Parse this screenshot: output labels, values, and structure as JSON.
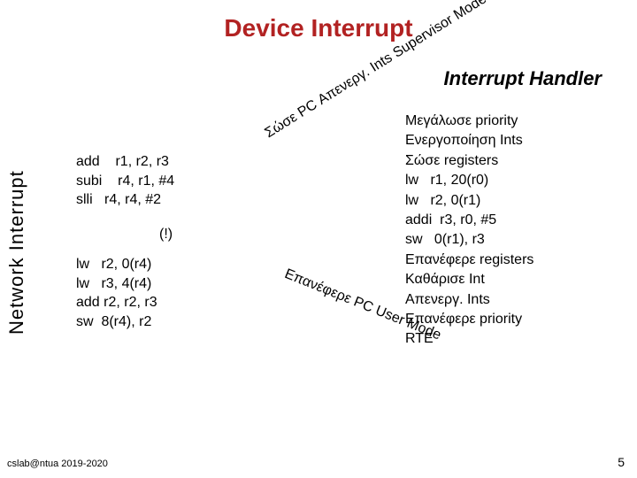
{
  "title": "Device Interrupt",
  "subtitle": "Interrupt Handler",
  "vertical_label": "Network Interrupt",
  "code_block1": "add    r1, r2, r3\nsubi    r4, r1, #4\nslli   r4, r4, #2",
  "exclaim": "(!)",
  "code_block2": "lw   r2, 0(r4)\nlw   r3, 4(r4)\nadd r2, r2, r3\nsw  8(r4), r2",
  "diag1": "Σώσε PC\nΑπενεργ. Ints\nSupervisor Mode",
  "diag2": "Επανέφερε PC\nUser Mode",
  "handler": "Μεγάλωσε priority\nΕνεργοποίηση Ints\nΣώσε registers\nlw   r1, 20(r0)\nlw   r2, 0(r1)\naddi  r3, r0, #5\nsw   0(r1), r3\nΕπανέφερε registers\nΚαθάρισε Int\nΑπενεργ. Ints\nΕπανέφερε priority\nRTE",
  "footer_left": "cslab@ntua 2019-2020",
  "footer_right": "5"
}
